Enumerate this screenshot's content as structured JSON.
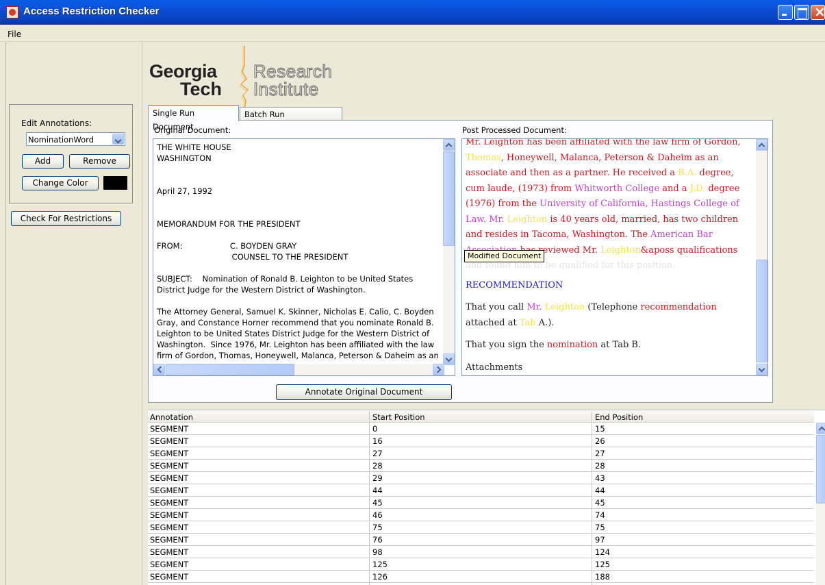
{
  "window": {
    "title": "Access Restriction Checker"
  },
  "menu": {
    "file": "File"
  },
  "logo": {
    "georgia": "Georgia",
    "tech": "Tech",
    "research": "Research",
    "institute": "Institute"
  },
  "annotations": {
    "label": "Edit Annotations:",
    "selected": "NominationWord",
    "add": "Add",
    "remove": "Remove",
    "change_color": "Change Color",
    "swatch_color": "#000000"
  },
  "check_button": "Check For Restrictions",
  "tabs": {
    "single": "Single Run Document",
    "batch": "Batch Run Configuration"
  },
  "original": {
    "label": "Original Document:",
    "text": "THE WHITE HOUSE\nWASHINGTON\n\n\nApril 27, 1992\n\n\nMEMORANDUM FOR THE PRESIDENT\n\nFROM:                   C. BOYDEN GRAY\n                              COUNSEL TO THE PRESIDENT\n\nSUBJECT:    Nomination of Ronald B. Leighton to be United States\nDistrict Judge for the Western District of Washington.\n\nThe Attorney General, Samuel K. Skinner, Nicholas E. Calio, C. Boyden\nGray, and Constance Horner recommend that you nominate Ronald B.\nLeighton to be United States District Judge for the Western District of\nWashington.  Since 1976, Mr. Leighton has been affiliated with the law\nfirm of Gordon, Thomas, Honeywell, Malanca, Peterson & Daheim as an"
  },
  "post": {
    "label": "Post Processed Document:",
    "tooltip": "Modified Document",
    "t_top_a": "Mr. Leighton has been affiliated with the law firm of Gordon,",
    "t_thomas": "Thomas",
    "t_l1b": ", Honeywell, Malanca, Peterson & Daheim as an",
    "t_l2": "associate and then as a partner. He received a",
    "t_ba": "B.A.",
    "t_l2b": " degree,",
    "t_l3a": "cum laude, (1973) from ",
    "t_whitworth": "Whitworth College",
    "t_l3b": " and a ",
    "t_jd": "J.D.",
    "t_l3c": " degree",
    "t_l4a": "(1976) from the ",
    "t_uc": "University of California, Hastings College of",
    "t_law": "Law. Mr. ",
    "t_leighton1": "Leighton",
    "t_l5b": " is 40 years old, married, has two children",
    "t_l6": "and resides in Tacoma, Washington. The ",
    "t_aba1": "American Bar",
    "t_aba2": "Association",
    "t_l7b": " has reviewed Mr. ",
    "t_leighton2": "Leighton",
    "t_l7c": "&aposs qualifications",
    "t_l8": "and found him to be qualified for this position.",
    "t_recommendation_head": "RECOMMENDATION",
    "t_call": "That you call ",
    "t_mr": "Mr. ",
    "t_leighton3": "Leighton",
    "t_tel": " (Telephone ",
    "t_recword": "recommendation",
    "t_attached": "attached at ",
    "t_tab": "Tab",
    "t_a": " A.).",
    "t_sign": "That you sign the ",
    "t_nomination": "nomination",
    "t_tabb": " at Tab B.",
    "t_attach": "Attachments"
  },
  "annotate_button": "Annotate Original Document",
  "table": {
    "headers": [
      "Annotation",
      "Start Position",
      "End Position"
    ],
    "rows": [
      [
        "SEGMENT",
        "0",
        "15"
      ],
      [
        "SEGMENT",
        "16",
        "26"
      ],
      [
        "SEGMENT",
        "27",
        "27"
      ],
      [
        "SEGMENT",
        "28",
        "28"
      ],
      [
        "SEGMENT",
        "29",
        "43"
      ],
      [
        "SEGMENT",
        "44",
        "44"
      ],
      [
        "SEGMENT",
        "45",
        "45"
      ],
      [
        "SEGMENT",
        "46",
        "74"
      ],
      [
        "SEGMENT",
        "75",
        "75"
      ],
      [
        "SEGMENT",
        "76",
        "97"
      ],
      [
        "SEGMENT",
        "98",
        "124"
      ],
      [
        "SEGMENT",
        "125",
        "125"
      ],
      [
        "SEGMENT",
        "126",
        "188"
      ]
    ]
  }
}
